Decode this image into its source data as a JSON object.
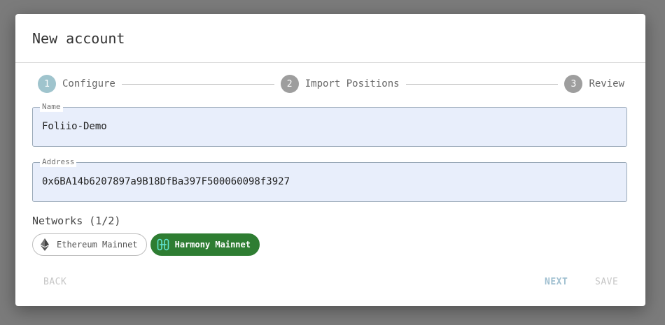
{
  "dialog": {
    "title": "New account"
  },
  "stepper": {
    "steps": [
      {
        "number": "1",
        "label": "Configure"
      },
      {
        "number": "2",
        "label": "Import Positions"
      },
      {
        "number": "3",
        "label": "Review"
      }
    ]
  },
  "form": {
    "name": {
      "label": "Name",
      "value": "Foliio-Demo"
    },
    "address": {
      "label": "Address",
      "value": "0x6BA14b6207897a9B18DfBa397F500060098f3927"
    }
  },
  "networks": {
    "label": "Networks (1/2)",
    "chips": [
      {
        "label": "Ethereum Mainnet",
        "icon": "ethereum-icon",
        "selected": false
      },
      {
        "label": "Harmony Mainnet",
        "icon": "harmony-icon",
        "selected": true
      }
    ],
    "selected_color": "#2e7d32"
  },
  "actions": {
    "back": "BACK",
    "next": "NEXT",
    "save": "SAVE"
  }
}
